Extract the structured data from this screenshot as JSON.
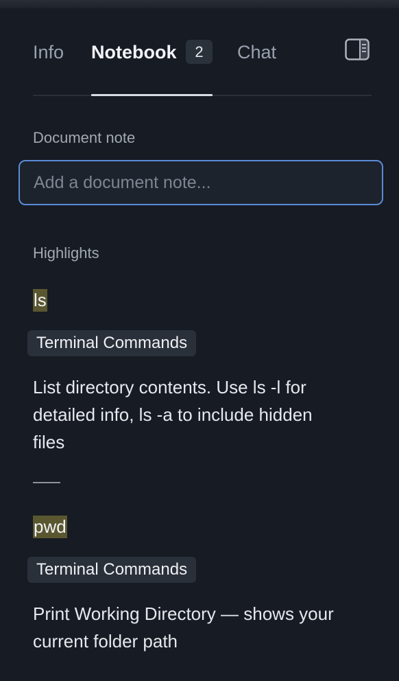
{
  "tabs": {
    "info": "Info",
    "notebook": "Notebook",
    "notebook_count": "2",
    "chat": "Chat"
  },
  "document_note": {
    "label": "Document note",
    "placeholder": "Add a document note...",
    "value": ""
  },
  "highlights": {
    "label": "Highlights",
    "items": [
      {
        "text": "ls",
        "tag": "Terminal Commands",
        "note": "List directory contents. Use ls -l for detailed info, ls -a to include hidden files"
      },
      {
        "text": "pwd",
        "tag": "Terminal Commands",
        "note": "Print Working Directory — shows your current folder path"
      }
    ]
  },
  "icons": {
    "panel_toggle": "sidebar-panel-icon"
  },
  "colors": {
    "background": "#161b24",
    "accent": "#5b8bd6",
    "highlight": "#5a5730",
    "tag_bg": "#2a303a"
  }
}
